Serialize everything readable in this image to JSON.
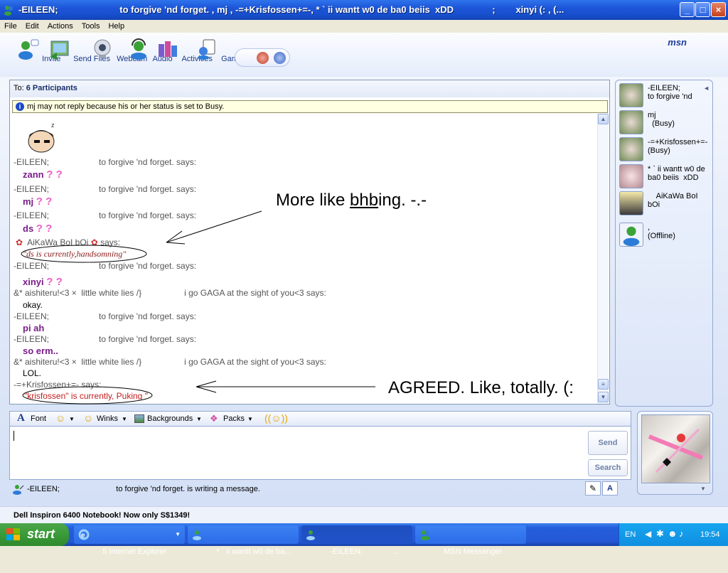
{
  "window": {
    "title": "-EILEEN;                        to forgive 'nd forget. , mj , -=+Krisfossen+=-, * ` ii wantt w0 de ba0 beiis  xDD               ;        xinyi (: , (...",
    "buttons": [
      "minimize",
      "maximize",
      "close"
    ]
  },
  "menu": [
    "File",
    "Edit",
    "Actions",
    "Tools",
    "Help"
  ],
  "toolbar": {
    "items": [
      {
        "label": "Invite",
        "icon": "invite-icon"
      },
      {
        "label": "Send Files",
        "icon": "send-files-icon"
      },
      {
        "label": "Webcam",
        "icon": "webcam-icon"
      },
      {
        "label": "Audio",
        "icon": "audio-icon"
      },
      {
        "label": "Activities",
        "icon": "activities-icon"
      },
      {
        "label": "Games",
        "icon": "games-icon"
      }
    ],
    "logo": "msn"
  },
  "conversation": {
    "to_label": "To:",
    "participants_label": "6 Participants",
    "notice": "mj may not reply because his or her status is set to Busy.",
    "messages": [
      {
        "sender": "-EILEEN;                     to forgive 'nd forget. says:",
        "text": "zann"
      },
      {
        "sender": "-EILEEN;                     to forgive 'nd forget. says:",
        "text": "mj"
      },
      {
        "sender": "-EILEEN;                     to forgive 'nd forget. says:",
        "text": "ds"
      },
      {
        "sender": "AiKaWa BoI bOi",
        "says": "says:",
        "text": "\"ds is currently,handsomning\""
      },
      {
        "sender": "-EILEEN;                     to forgive 'nd forget. says:",
        "text": "xinyi"
      },
      {
        "sender": "&* aishiteru!<3 ×  little white lies /}                  i go GAGA at the sight of you<3 says:",
        "text": "okay."
      },
      {
        "sender": "-EILEEN;                     to forgive 'nd forget. says:",
        "text": "pi ah"
      },
      {
        "sender": "-EILEEN;                     to forgive 'nd forget. says:",
        "text": "so erm.."
      },
      {
        "sender": "&* aishiteru!<3 ×  little white lies /}                  i go GAGA at the sight of you<3 says:",
        "text": "LOL."
      },
      {
        "sender": "-=+Krisfossen+=- says:",
        "text": "\"krisfossen\" is currently, Puking \""
      }
    ],
    "annotations": [
      "More like bhbing. -.-",
      "AGREED. Like, totally. (:"
    ],
    "annotation_underline": "bhb"
  },
  "format_bar": {
    "font": "Font",
    "winks": "Winks",
    "backgrounds": "Backgrounds",
    "packs": "Packs"
  },
  "input": {
    "value": "",
    "send": "Send",
    "search": "Search"
  },
  "status_line": "-EILEEN;                          to forgive 'nd forget. is writing a message.",
  "participants": [
    {
      "name": "-EILEEN;\nto forgive 'nd"
    },
    {
      "name": "mj\n  (Busy)"
    },
    {
      "name": "-=+Krisfossen+=-\n(Busy)"
    },
    {
      "name": "* ` ii wantt w0 de\nba0 beiis  xDD"
    },
    {
      "name": "    AiKaWa BoI\nbOi"
    },
    {
      "name": ",\n(Offline)"
    }
  ],
  "ad": "Dell Inspiron 6400 Notebook! Now only S$1349!",
  "taskbar": {
    "start": "start",
    "tasks": [
      {
        "label": "5 Internet Explorer",
        "icon": "ie-icon"
      },
      {
        "label": "* ` ii wantt w0 de ba...",
        "icon": "msn-chat-icon"
      },
      {
        "label": "-EILEEN;              ...",
        "icon": "msn-chat-icon"
      },
      {
        "label": "MSN Messenger",
        "icon": "msn-icon"
      }
    ],
    "lang": "EN",
    "clock": "19:54"
  },
  "colors": {
    "titlebar": "#1f58d8",
    "taskbar": "#245edb",
    "start": "#3a9a38",
    "msg": "#7b1c8a"
  }
}
